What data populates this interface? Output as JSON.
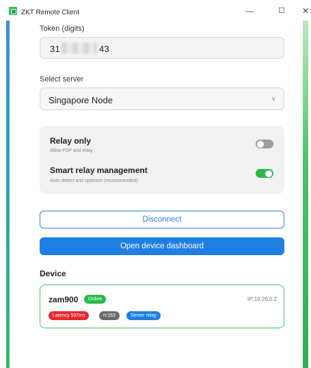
{
  "window": {
    "title": "ZKT Remote Client",
    "controls": {
      "minimize": "—",
      "maximize": "☐",
      "close": "✕"
    }
  },
  "token": {
    "label": "Token (digits)",
    "value_prefix": "31",
    "value_suffix": "43"
  },
  "server": {
    "label": "Select server",
    "selected": "Singapore Node",
    "chevron": "˅"
  },
  "options": {
    "relay_only": {
      "title": "Relay only",
      "subtitle": "Allow P2P and relay",
      "enabled": false
    },
    "smart_relay": {
      "title": "Smart relay management",
      "subtitle": "Auto detect and optimize (recommended)",
      "enabled": true
    }
  },
  "actions": {
    "disconnect": "Disconnect",
    "dashboard": "Open device dashboard"
  },
  "device": {
    "section_title": "Device",
    "name": "zam900",
    "status": "Online",
    "ip": "IP:10.26.0.2",
    "latency": "Latency 537ms",
    "rt": "rt:163",
    "mode": "Server relay"
  },
  "colors": {
    "accent": "#1f7fe3",
    "online": "#2ab84a",
    "latency": "#e8282d",
    "rt": "#6b6b6b",
    "mode": "#1f7fe3"
  }
}
